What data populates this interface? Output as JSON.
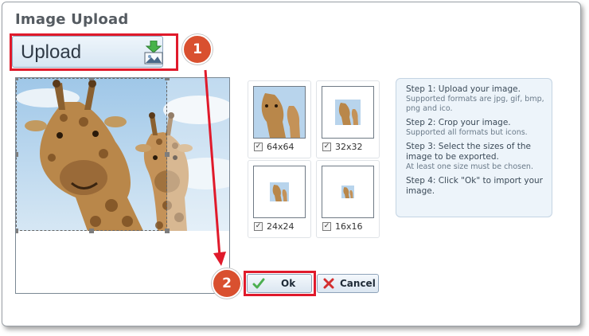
{
  "dialog": {
    "title": "Image Upload"
  },
  "upload": {
    "label": "Upload",
    "icon": "image-upload-icon"
  },
  "annotations": {
    "badge_1": "1",
    "badge_2": "2",
    "highlight_color": "#e01a2b",
    "badge_color": "#d9502f"
  },
  "thumbnails": [
    {
      "size_label": "64x64",
      "checked": true
    },
    {
      "size_label": "32x32",
      "checked": true
    },
    {
      "size_label": "24x24",
      "checked": true
    },
    {
      "size_label": "16x16",
      "checked": true
    }
  ],
  "help": {
    "steps": [
      {
        "main": "Step 1: Upload your image.",
        "sub": "Supported formats are jpg, gif, bmp, png and ico."
      },
      {
        "main": "Step 2: Crop your image.",
        "sub": "Supported all formats but icons."
      },
      {
        "main": "Step 3: Select the sizes of the image to be exported.",
        "sub": "At least one size must be chosen."
      },
      {
        "main": "Step 4: Click \"Ok\" to import your image.",
        "sub": ""
      }
    ]
  },
  "buttons": {
    "ok_label": "Ok",
    "cancel_label": "Cancel",
    "ok_icon": "checkmark-icon",
    "cancel_icon": "cross-icon"
  }
}
